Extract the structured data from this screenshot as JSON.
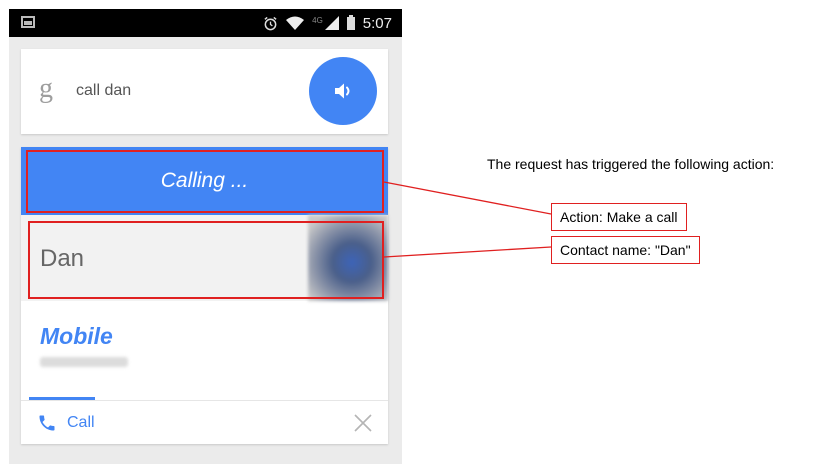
{
  "status_bar": {
    "network_label": "4G",
    "time": "5:07"
  },
  "search": {
    "logo": "g",
    "query": "call dan"
  },
  "result": {
    "calling_label": "Calling ...",
    "contact_name": "Dan",
    "phone_type": "Mobile",
    "call_label": "Call"
  },
  "annotations": {
    "heading": "The request has triggered the following action:",
    "action_label": "Action: Make a call",
    "contact_label": "Contact name: \"Dan\""
  },
  "colors": {
    "accent_blue": "#4285f4",
    "annotation_red": "#e02020"
  },
  "icons": [
    "screenshot-icon",
    "alarm-icon",
    "wifi-icon",
    "signal-icon",
    "battery-icon",
    "google-g-icon",
    "speaker-icon",
    "contact-photo",
    "phone-icon",
    "close-icon"
  ]
}
